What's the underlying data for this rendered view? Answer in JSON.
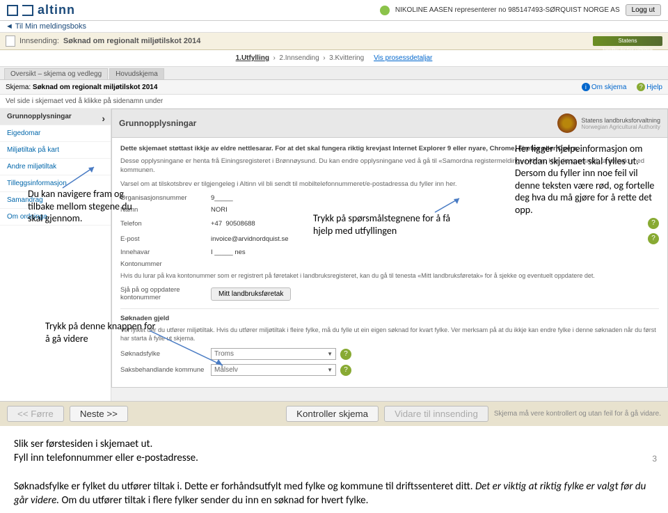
{
  "altinn": {
    "logo_text": "altinn",
    "user_text": "NIKOLINE AASEN representerer no 985147493-SØRQUIST NORGE AS",
    "logout": "Logg ut"
  },
  "back": "Til Min meldingsboks",
  "title_bar": {
    "prefix": "Innsending:",
    "title": "Søknad om regionalt miljøtilskot 2014",
    "authority": "Statens landbruksforvaltning"
  },
  "steps": {
    "s1": "1.Utfylling",
    "s2": "2.Innsending",
    "s3": "3.Kvittering",
    "detail": "Vis prosessdetaljar"
  },
  "tabs": {
    "t1": "Oversikt – skjema og vedlegg",
    "t2": "Hovudskjema"
  },
  "schema": {
    "label": "Skjema:",
    "name": "Søknad om regionalt miljøtilskot 2014",
    "about": "Om skjema",
    "help": "Hjelp"
  },
  "instr": "Vel side i skjemaet ved å klikke på sidenamn under",
  "sidebar": {
    "items": [
      {
        "label": "Grunnopplysningar"
      },
      {
        "label": "Eigedomar"
      },
      {
        "label": "Miljøtiltak på kart"
      },
      {
        "label": "Andre miljøtiltak"
      },
      {
        "label": "Tilleggsinformasjon"
      },
      {
        "label": "Samandrag"
      },
      {
        "label": "Om ordninga"
      }
    ]
  },
  "form": {
    "heading": "Grunnopplysningar",
    "logo_name": "Statens landbruksforvaltning",
    "logo_sub": "Norwegian Agricultural Authority",
    "p1": "Dette skjemaet støttast ikkje av eldre nettlesarar. For at det skal fungera riktig krevjast Internet Explorer 9 eller nyare, Chrome, Firefox eller Opera.",
    "p2": "Desse opplysningane er henta frå Einingsregisteret i Brønnøysund. Du kan endre opplysningane ved å gå til «Samordna registermelding» i Altinn. Har du spørsmål, ta kontakt med kommunen.",
    "p3": "Varsel om at tilskotsbrev er tilgjengeleg i Altinn vil bli sendt til mobiltelefonnummeret/e-postadressa du fyller inn her.",
    "fields": {
      "orgnr_lbl": "Organisasjonsnummer",
      "orgnr_val": "9_____",
      "namn_lbl": "Namn",
      "namn_val": "NORI",
      "tlf_lbl": "Telefon",
      "tlf_prefix": "+47",
      "tlf_val": "90508688",
      "epost_lbl": "E-post",
      "epost_val": "invoice@arvidnordquist.se",
      "innehavar_lbl": "Innehavar",
      "innehavar_val": "I _____ nes",
      "konto_lbl": "Kontonummer",
      "konto_val": ""
    },
    "konto_help": "Hvis du lurar på kva kontonummer som er registrert på føretaket i landbruksregisteret, kan du gå til tenesta «Mitt landbruksføretak» for å sjekke og eventuelt oppdatere det.",
    "sjaa_lbl": "Sjå på og oppdatere kontonummer",
    "sjaa_btn": "Mitt landbruksføretak",
    "soknaden_title": "Søknaden gjeld",
    "soknaden_p": "Vel fylket der du utfører miljøtiltak. Hvis du utfører miljøtiltak i fleire fylke, må du fylle ut ein eigen søknad for kvart fylke. Ver merksam på at du ikkje kan endre fylke i denne søknaden når du først har starta å fylle ut skjema.",
    "fylke_lbl": "Søknadsfylke",
    "fylke_val": "Troms",
    "kommune_lbl": "Saksbehandlande kommune",
    "kommune_val": "Målselv"
  },
  "botbar": {
    "prev": "<< Førre",
    "next": "Neste >>",
    "check": "Kontroller skjema",
    "send": "Vidare til innsending",
    "note": "Skjema må vere kontrollert og utan feil for å gå vidare."
  },
  "annotations": {
    "a1": "Du kan navigere fram og tilbake mellom stegene du skal gjennom.",
    "a2": "Trykk på spørsmålstegnene for å få hjelp med utfyllingen",
    "a3": "Her ligger hjelpeinformasjon om hvordan skjemaet skal fylles ut. Dersom du fyller inn noe feil vil denne teksten være rød, og fortelle deg hva du må gjøre for å rette det opp.",
    "a4": "Trykk på denne knappen for å gå videre"
  },
  "caption": {
    "p1": "Slik ser førstesiden i skjemaet ut.",
    "p2": "Fyll inn telefonnummer eller e-postadresse.",
    "p3a": "Søknadsfylke er fylket du utfører tiltak i. Dette er forhåndsutfylt med fylke og kommune til driftssenteret ditt. ",
    "p3b": "Det er viktig at riktig fylke er valgt før du går videre. ",
    "p3c": "Om du utfører tiltak i flere fylker sender du inn en søknad for hvert fylke."
  },
  "page_number": "3"
}
